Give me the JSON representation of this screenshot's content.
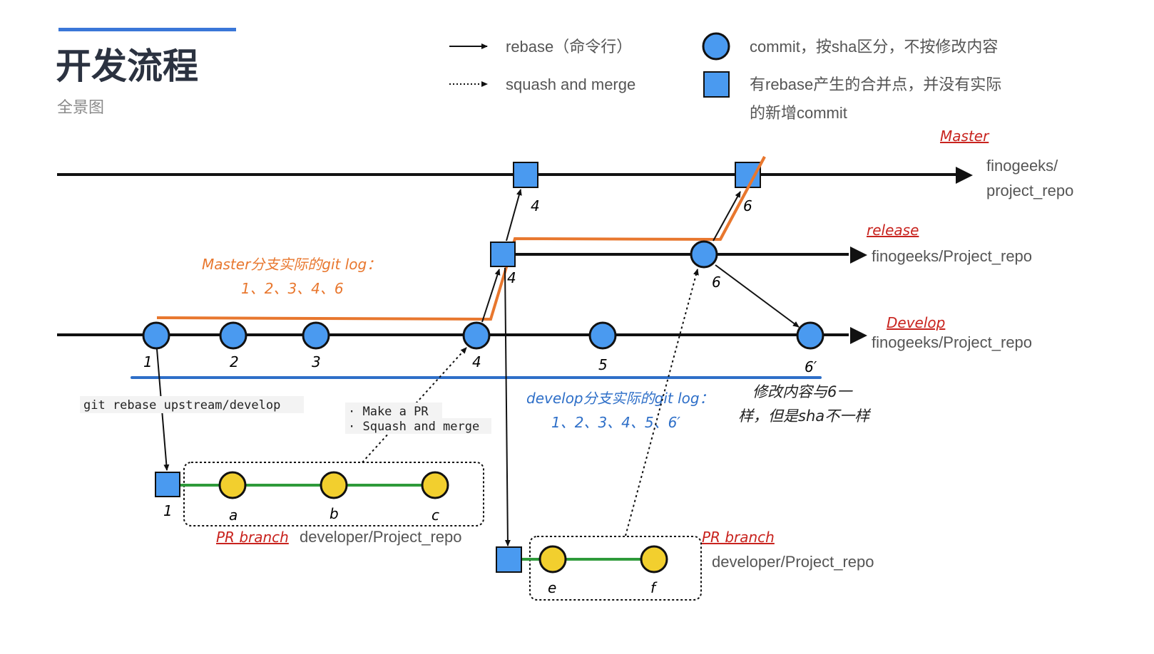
{
  "header": {
    "title": "开发流程",
    "subtitle": "全景图"
  },
  "legend": {
    "rebase": "rebase（命令行）",
    "squash": "squash and merge",
    "commit": "commit，按sha区分，不按修改内容",
    "merge_point_line1": "有rebase产生的合并点，并没有实际",
    "merge_point_line2": "的新增commit"
  },
  "branches": {
    "master": {
      "label": "Master",
      "repo_line1": "finogeeks/",
      "repo_line2": "project_repo",
      "commits": [
        "4",
        "6"
      ]
    },
    "release": {
      "label": "release",
      "repo": "finogeeks/Project_repo",
      "commits": [
        "4",
        "6"
      ]
    },
    "develop": {
      "label": "Develop",
      "repo": "finogeeks/Project_repo",
      "commits": [
        "1",
        "2",
        "3",
        "4",
        "5",
        "6′"
      ]
    }
  },
  "notes": {
    "master_log_title": "Master分支实际的git log：",
    "master_log": "1、2、3、4、6",
    "develop_log_title": "develop分支实际的git log：",
    "develop_log": "1、2、3、4、5、6′",
    "diff_note_line1": "修改内容与6一",
    "diff_note_line2": "样，但是sha不一样",
    "rebase_cmd": "git rebase upstream/develop",
    "pr_step1": "· Make a PR",
    "pr_step2": "· Squash and merge"
  },
  "pr1": {
    "label": "PR branch",
    "repo": "developer/Project_repo",
    "base": "1",
    "commits": [
      "a",
      "b",
      "c"
    ]
  },
  "pr2": {
    "label": "PR branch",
    "repo": "developer/Project_repo",
    "commits": [
      "e",
      "f"
    ]
  },
  "colors": {
    "accent": "#3a77d8",
    "commit": "#4a9af0",
    "pr_commit": "#f2cf2e",
    "master_log": "#e8772e",
    "develop_log": "#2e6fc8",
    "branch_label": "#c8231e",
    "pr_line": "#2e9a3a"
  }
}
